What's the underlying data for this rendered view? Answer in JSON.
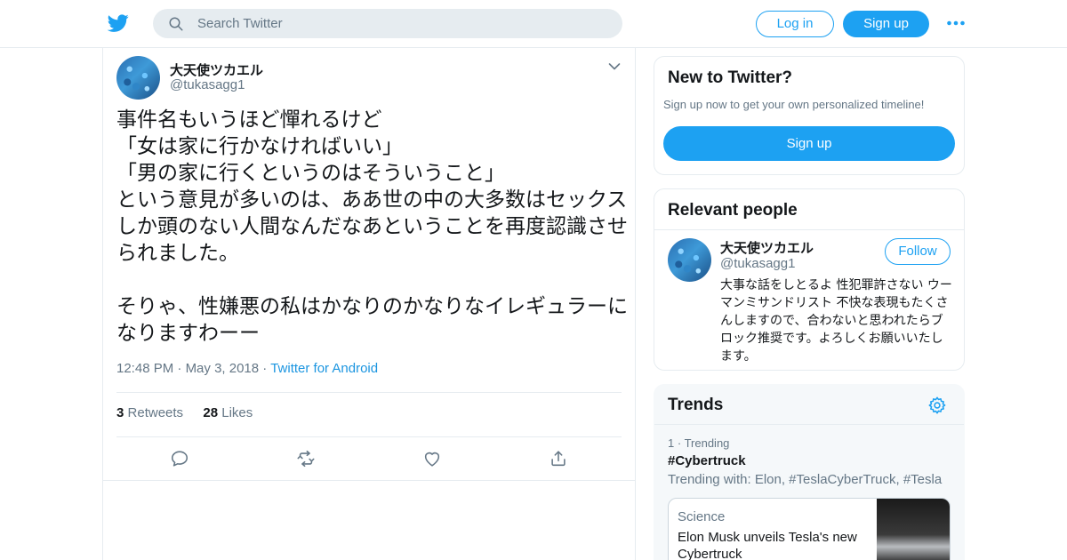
{
  "colors": {
    "brand": "#1da1f2",
    "text": "#14171a",
    "muted": "#657786",
    "border": "#e6ecf0"
  },
  "header": {
    "logo_icon": "twitter-bird-icon",
    "search_placeholder": "Search Twitter",
    "login_label": "Log in",
    "signup_label": "Sign up",
    "more_icon": "more-dots-icon"
  },
  "tweet": {
    "author_name": "大天使ツカエル",
    "author_handle": "@tukasagg1",
    "text": "事件名もいうほど憚れるけど\n「女は家に行かなければいい」\n「男の家に行くというのはそういうこと」\nという意見が多いのは、ああ世の中の大多数はセックスしか頭のない人間なんだなあということを再度認識させられました。\n\nそりゃ、性嫌悪の私はかなりのかなりなイレギュラーになりますわーー",
    "time": "12:48 PM",
    "date": "May 3, 2018",
    "source": "Twitter for Android",
    "retweets_count": "3",
    "retweets_label": "Retweets",
    "likes_count": "28",
    "likes_label": "Likes"
  },
  "sidebar": {
    "signup_card": {
      "title": "New to Twitter?",
      "subtitle": "Sign up now to get your own personalized timeline!",
      "button": "Sign up"
    },
    "relevant_people": {
      "title": "Relevant people",
      "name": "大天使ツカエル",
      "handle": "@tukasagg1",
      "follow_label": "Follow",
      "bio": "大事な話をしとるよ 性犯罪許さない ウーマンミサンドリスト 不快な表現もたくさんしますので、合わないと思われたらブロック推奨です。よろしくお願いいたします。"
    },
    "trends": {
      "title": "Trends",
      "rank": "1",
      "rank_label": "Trending",
      "hashtag": "#Cybertruck",
      "trending_with": "Trending with: Elon, #TeslaCyberTruck, #Tesla",
      "news_category": "Science",
      "news_title": "Elon Musk unveils Tesla's new Cybertruck"
    }
  }
}
